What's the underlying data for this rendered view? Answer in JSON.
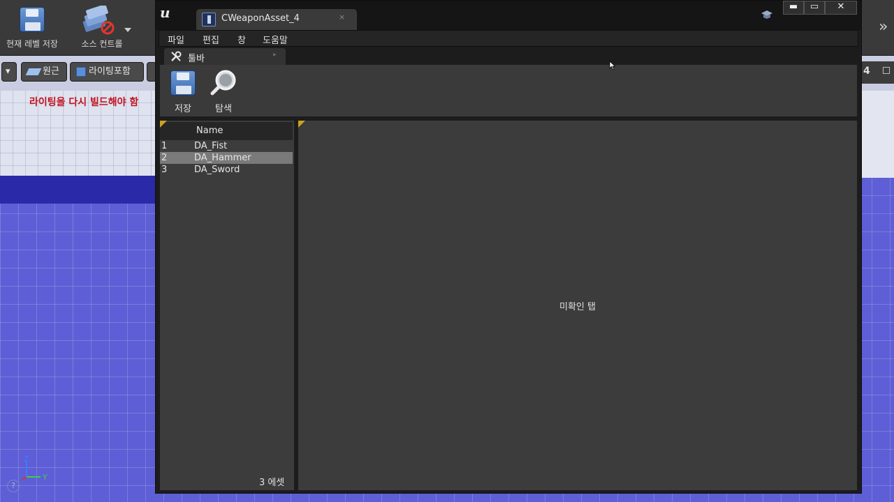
{
  "background_editor": {
    "toolbar": {
      "save_level_label": "현재 레벨 저장",
      "source_control_label": "소스 컨트롤"
    },
    "sub_toolbar": {
      "dropdown_glyph": "▾",
      "perspective_label": "원근",
      "lighting_label": "라이팅포함"
    },
    "warning_text": "라이팅을 다시 빌드해야 함",
    "right_panel_value": "4",
    "axis": {
      "z": "Z",
      "y": "Y"
    },
    "help_glyph": "?",
    "chevron_glyph": "»"
  },
  "window": {
    "logo_glyph": "u",
    "tab_title": "CWeaponAsset_4",
    "tab_close_glyph": "×",
    "window_buttons": {
      "minimize": "▬",
      "maximize": "▭",
      "close": "✕"
    },
    "menu": [
      "파일",
      "편집",
      "창",
      "도움말"
    ],
    "toolbar_tab_label": "툴바",
    "toolbar_tab_icon": "✕",
    "tools": {
      "save_label": "저장",
      "browse_label": "탐색"
    },
    "asset_list": {
      "column_header": "Name",
      "rows": [
        {
          "num": "1",
          "name": "DA_Fist",
          "selected": false
        },
        {
          "num": "2",
          "name": "DA_Hammer",
          "selected": true
        },
        {
          "num": "3",
          "name": "DA_Sword",
          "selected": false
        }
      ],
      "count_label": "3 에셋"
    },
    "detail_panel": {
      "empty_label": "미확인 탭"
    }
  },
  "colors": {
    "window_bg": "#1c1c1c",
    "panel_bg": "#3c3c3c",
    "selected_row": "#7a7a7a",
    "corner_accent": "#d1a11c",
    "warning_red": "#c1121f",
    "viewport_floor": "#5e5ed6"
  }
}
